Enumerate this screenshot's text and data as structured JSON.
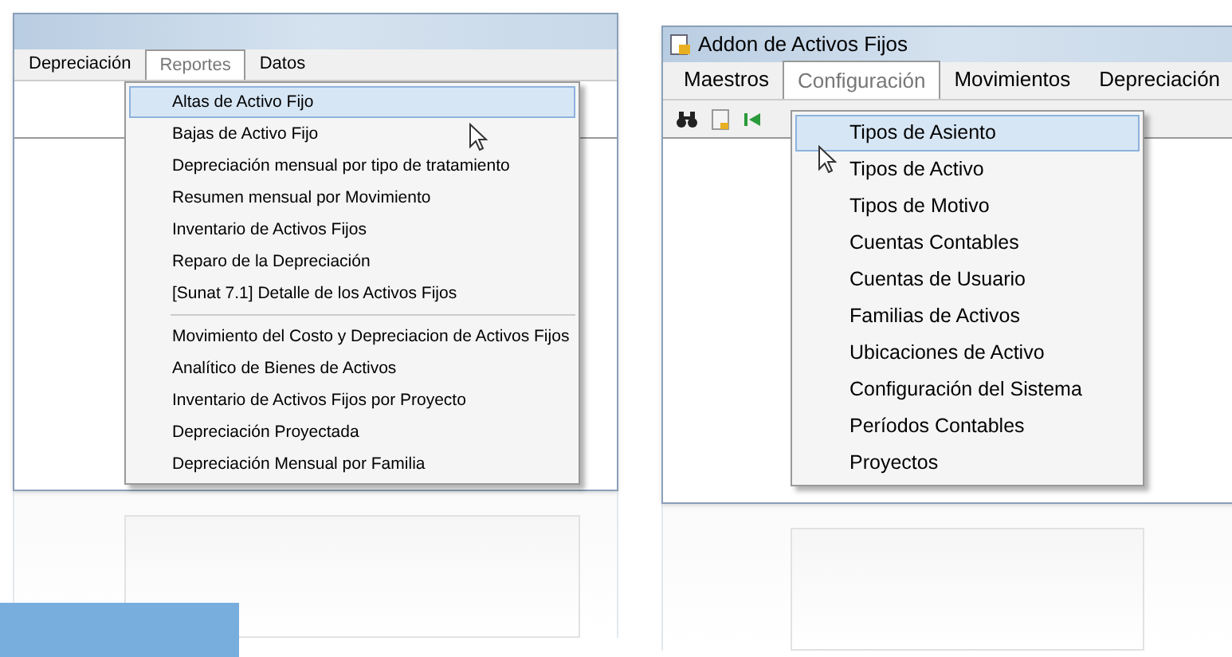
{
  "windows": [
    {
      "menu": [
        {
          "label": "Depreciación",
          "selected": false
        },
        {
          "label": "Reportes",
          "selected": true
        },
        {
          "label": "Datos",
          "selected": false
        }
      ],
      "toolbar": false,
      "dropdown": [
        {
          "label": "Altas de Activo Fijo",
          "selected": true,
          "separator_before": false
        },
        {
          "label": "Bajas de Activo Fijo",
          "selected": false,
          "separator_before": false
        },
        {
          "label": "Depreciación mensual por tipo de tratamiento",
          "selected": false,
          "separator_before": false
        },
        {
          "label": "Resumen mensual por Movimiento",
          "selected": false,
          "separator_before": false
        },
        {
          "label": "Inventario de Activos Fijos",
          "selected": false,
          "separator_before": false
        },
        {
          "label": "Reparo de la Depreciación",
          "selected": false,
          "separator_before": false
        },
        {
          "label": "[Sunat 7.1] Detalle de los Activos Fijos",
          "selected": false,
          "separator_before": false
        },
        {
          "label": "Movimiento del Costo y Depreciacion de Activos Fijos",
          "selected": false,
          "separator_before": true
        },
        {
          "label": "Analítico de Bienes de Activos",
          "selected": false,
          "separator_before": false
        },
        {
          "label": "Inventario de Activos Fijos por Proyecto",
          "selected": false,
          "separator_before": false
        },
        {
          "label": "Depreciación Proyectada",
          "selected": false,
          "separator_before": false
        },
        {
          "label": "Depreciación Mensual por Familia",
          "selected": false,
          "separator_before": false
        }
      ]
    },
    {
      "title": "Addon de Activos Fijos",
      "menu": [
        {
          "label": "Maestros",
          "selected": false
        },
        {
          "label": "Configuración",
          "selected": true
        },
        {
          "label": "Movimientos",
          "selected": false
        },
        {
          "label": "Depreciación",
          "selected": false
        }
      ],
      "toolbar": true,
      "dropdown": [
        {
          "label": "Tipos de Asiento",
          "selected": true,
          "separator_before": false
        },
        {
          "label": "Tipos de Activo",
          "selected": false,
          "separator_before": false
        },
        {
          "label": "Tipos de Motivo",
          "selected": false,
          "separator_before": false
        },
        {
          "label": "Cuentas Contables",
          "selected": false,
          "separator_before": false
        },
        {
          "label": "Cuentas de Usuario",
          "selected": false,
          "separator_before": false
        },
        {
          "label": "Familias de Activos",
          "selected": false,
          "separator_before": false
        },
        {
          "label": "Ubicaciones de Activo",
          "selected": false,
          "separator_before": false
        },
        {
          "label": "Configuración del Sistema",
          "selected": false,
          "separator_before": false
        },
        {
          "label": "Períodos Contables",
          "selected": false,
          "separator_before": false
        },
        {
          "label": "Proyectos",
          "selected": false,
          "separator_before": false
        }
      ]
    }
  ]
}
